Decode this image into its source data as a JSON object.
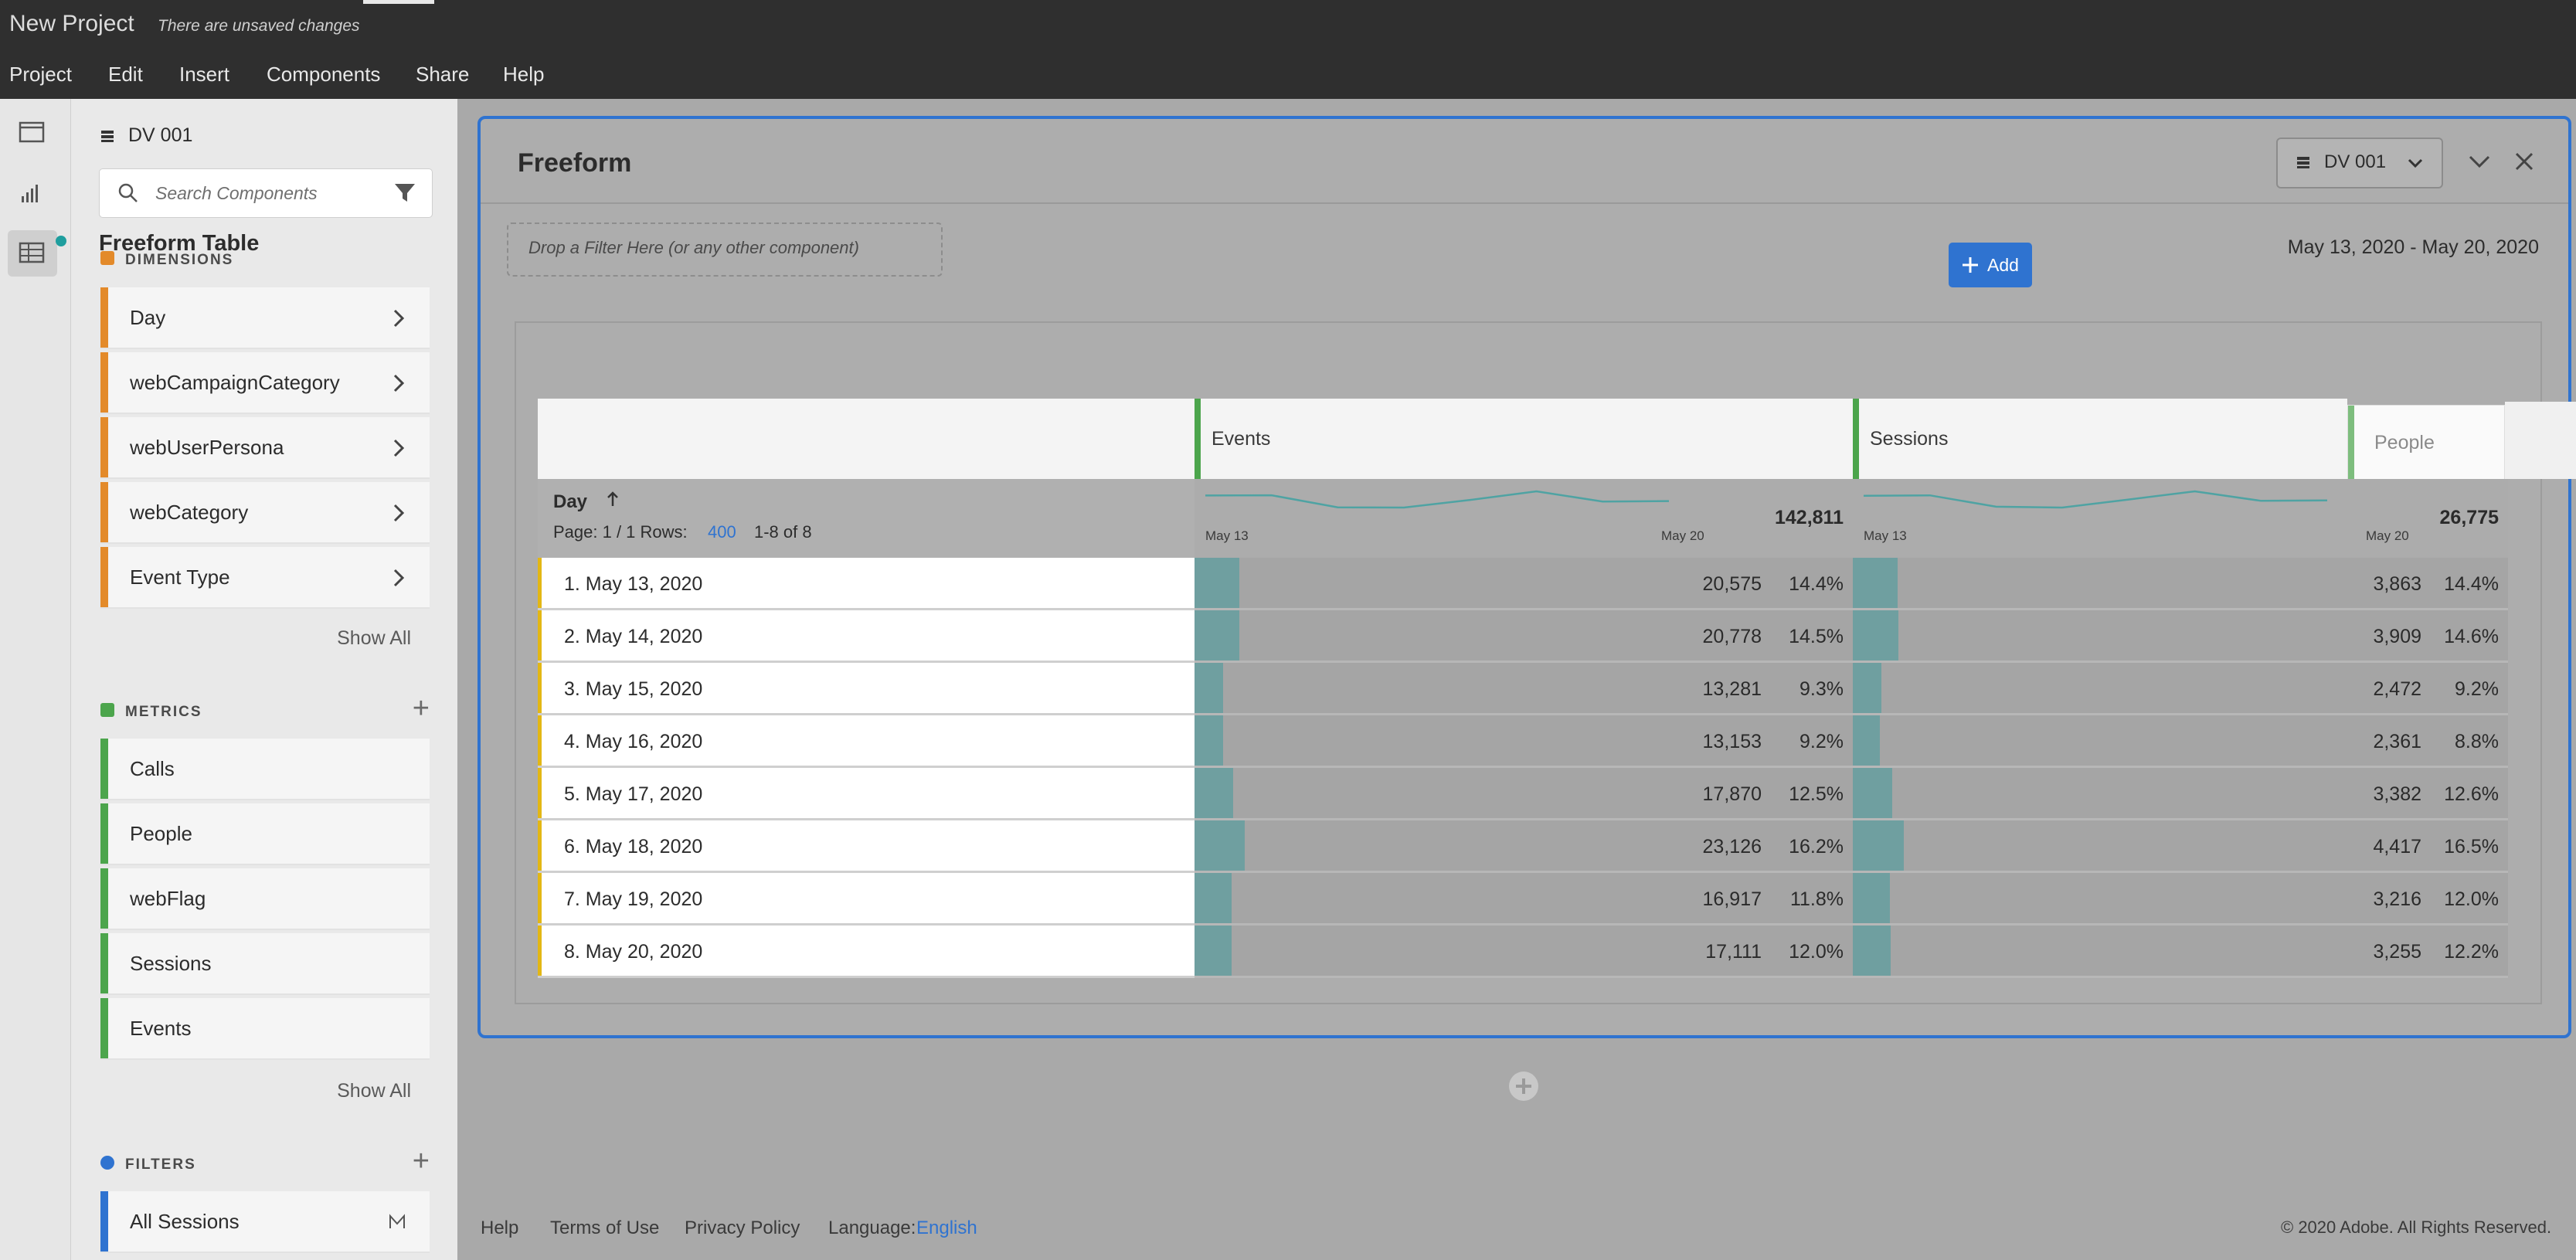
{
  "app": {
    "title": "New Project",
    "status": "There are unsaved changes"
  },
  "menu": [
    "Project",
    "Edit",
    "Insert",
    "Components",
    "Share",
    "Help"
  ],
  "rail": {
    "icons": [
      "panel-icon",
      "visualizations-icon",
      "components-icon"
    ]
  },
  "panel": {
    "dataview": "DV 001",
    "search_placeholder": "Search Components",
    "dimensions": {
      "header": "DIMENSIONS",
      "items": [
        "Day",
        "webCampaignCategory",
        "webUserPersona",
        "webCategory",
        "Event Type"
      ],
      "show_all": "Show All"
    },
    "metrics": {
      "header": "METRICS",
      "items": [
        "Calls",
        "People",
        "webFlag",
        "Sessions",
        "Events"
      ],
      "show_all": "Show All"
    },
    "filters": {
      "header": "FILTERS",
      "items": [
        "All Sessions"
      ]
    }
  },
  "freeform": {
    "title": "Freeform",
    "dataview_button": "DV 001",
    "drop_placeholder": "Drop a Filter Here (or any other component)",
    "date_range": "May 13, 2020 - May 20, 2020",
    "table_title": "Freeform Table",
    "add_label": "Add",
    "dimension_header": "Day",
    "page_label": "Page: 1 / 1 Rows:",
    "rows_value": "400",
    "range_label": "1-8 of 8",
    "columns": [
      {
        "name": "Events",
        "total": "142,811",
        "start": "May 13",
        "end": "May 20"
      },
      {
        "name": "Sessions",
        "total": "26,775",
        "start": "May 13",
        "end": "May 20"
      },
      {
        "name": "People"
      }
    ],
    "rows": [
      {
        "label": "1. May 13, 2020",
        "events": "20,575",
        "events_pct": "14.4%",
        "events_frac": 0.144,
        "sessions": "3,863",
        "sessions_pct": "14.4%",
        "sessions_frac": 0.144
      },
      {
        "label": "2. May 14, 2020",
        "events": "20,778",
        "events_pct": "14.5%",
        "events_frac": 0.145,
        "sessions": "3,909",
        "sessions_pct": "14.6%",
        "sessions_frac": 0.146
      },
      {
        "label": "3. May 15, 2020",
        "events": "13,281",
        "events_pct": "9.3%",
        "events_frac": 0.093,
        "sessions": "2,472",
        "sessions_pct": "9.2%",
        "sessions_frac": 0.092
      },
      {
        "label": "4. May 16, 2020",
        "events": "13,153",
        "events_pct": "9.2%",
        "events_frac": 0.092,
        "sessions": "2,361",
        "sessions_pct": "8.8%",
        "sessions_frac": 0.088
      },
      {
        "label": "5. May 17, 2020",
        "events": "17,870",
        "events_pct": "12.5%",
        "events_frac": 0.125,
        "sessions": "3,382",
        "sessions_pct": "12.6%",
        "sessions_frac": 0.126
      },
      {
        "label": "6. May 18, 2020",
        "events": "23,126",
        "events_pct": "16.2%",
        "events_frac": 0.162,
        "sessions": "4,417",
        "sessions_pct": "16.5%",
        "sessions_frac": 0.165
      },
      {
        "label": "7. May 19, 2020",
        "events": "16,917",
        "events_pct": "11.8%",
        "events_frac": 0.118,
        "sessions": "3,216",
        "sessions_pct": "12.0%",
        "sessions_frac": 0.12
      },
      {
        "label": "8. May 20, 2020",
        "events": "17,111",
        "events_pct": "12.0%",
        "events_frac": 0.12,
        "sessions": "3,255",
        "sessions_pct": "12.2%",
        "sessions_frac": 0.122
      }
    ]
  },
  "footer": {
    "help": "Help",
    "terms": "Terms of Use",
    "privacy": "Privacy Policy",
    "language_label": "Language:",
    "language_value": "English",
    "copyright": "© 2020 Adobe. All Rights Reserved."
  },
  "colors": {
    "accent": "#2f73d0",
    "dimension_bar": "#e38a2a",
    "metric_bar": "#4ca54c",
    "filter_bar": "#2f73d0",
    "row_marker": "#e3b714",
    "data_fill": "#6f9fa0"
  }
}
